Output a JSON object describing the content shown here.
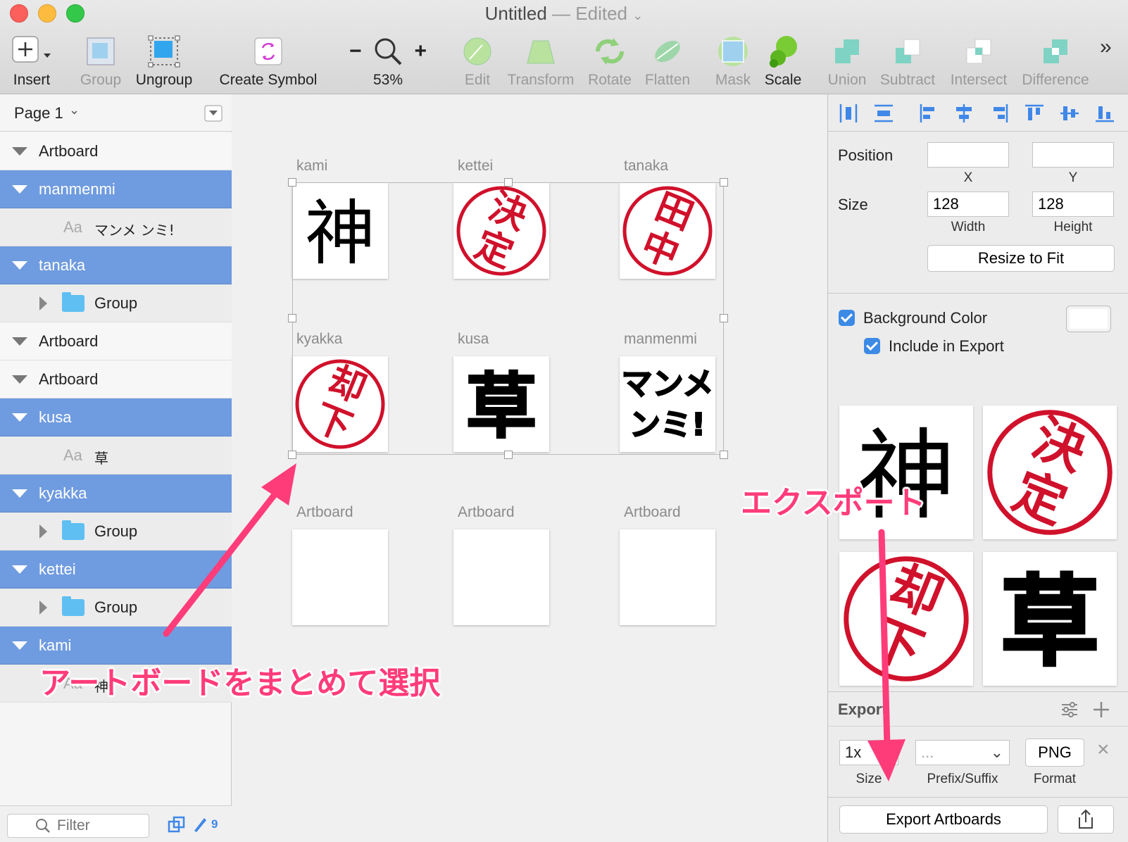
{
  "window": {
    "title": "Untitled",
    "title_separator": "—",
    "title_status": "Edited"
  },
  "toolbar": {
    "insert": "Insert",
    "group": "Group",
    "ungroup": "Ungroup",
    "create_symbol": "Create Symbol",
    "zoom_minus": "−",
    "zoom_plus": "+",
    "zoom": "53%",
    "edit": "Edit",
    "transform": "Transform",
    "rotate": "Rotate",
    "flatten": "Flatten",
    "mask": "Mask",
    "scale": "Scale",
    "union": "Union",
    "subtract": "Subtract",
    "intersect": "Intersect",
    "difference": "Difference",
    "more": "»"
  },
  "sidebar": {
    "page": "Page 1",
    "layers": [
      {
        "label": "Artboard",
        "kind": "artboard"
      },
      {
        "label": "manmenmi",
        "kind": "selected"
      },
      {
        "label": "マンメ ンミ!",
        "kind": "text",
        "prefix": "Aa"
      },
      {
        "label": "tanaka",
        "kind": "selected"
      },
      {
        "label": "Group",
        "kind": "group"
      },
      {
        "label": "Artboard",
        "kind": "artboard"
      },
      {
        "label": "Artboard",
        "kind": "artboard"
      },
      {
        "label": "kusa",
        "kind": "selected"
      },
      {
        "label": "草",
        "kind": "text",
        "prefix": "Aa"
      },
      {
        "label": "kyakka",
        "kind": "selected"
      },
      {
        "label": "Group",
        "kind": "group"
      },
      {
        "label": "kettei",
        "kind": "selected"
      },
      {
        "label": "Group",
        "kind": "group"
      },
      {
        "label": "kami",
        "kind": "selected"
      },
      {
        "label": "神",
        "kind": "text",
        "prefix": "Aa"
      }
    ],
    "filter_placeholder": "Filter",
    "count": "9"
  },
  "canvas": {
    "artboards": [
      {
        "label": "kami",
        "glyph": "神",
        "style": "plain"
      },
      {
        "label": "kettei",
        "glyph": "決定",
        "style": "stamp"
      },
      {
        "label": "tanaka",
        "glyph": "田中",
        "style": "stamp"
      },
      {
        "label": "kyakka",
        "glyph": "却下",
        "style": "stamp"
      },
      {
        "label": "kusa",
        "glyph": "草",
        "style": "bold"
      },
      {
        "label": "manmenmi",
        "glyph": "マンメ\nンミ!",
        "style": "heavy"
      },
      {
        "label": "Artboard",
        "glyph": "",
        "style": "empty"
      },
      {
        "label": "Artboard",
        "glyph": "",
        "style": "empty"
      },
      {
        "label": "Artboard",
        "glyph": "",
        "style": "empty"
      }
    ]
  },
  "inspector": {
    "position": "Position",
    "x_value": "",
    "y_value": "",
    "x_label": "X",
    "y_label": "Y",
    "size": "Size",
    "width_value": "128",
    "height_value": "128",
    "width_label": "Width",
    "height_label": "Height",
    "resize_to_fit": "Resize to Fit",
    "background_color": "Background Color",
    "include_in_export": "Include in Export",
    "previews": [
      "神",
      "決定",
      "却下",
      "草"
    ],
    "export_title": "Export",
    "export_size": "1x",
    "export_prefix": "...",
    "export_format": "PNG",
    "size_label": "Size",
    "prefix_label": "Prefix/Suffix",
    "format_label": "Format",
    "export_artboards": "Export Artboards"
  },
  "annotations": {
    "select_text": "アートボードをまとめて選択",
    "export_text": "エクスポート"
  },
  "colors": {
    "selection": "#6f9be0",
    "stamp_red": "#d0112b",
    "annotation": "#ff3c7a",
    "checkbox": "#3d8ae6"
  }
}
